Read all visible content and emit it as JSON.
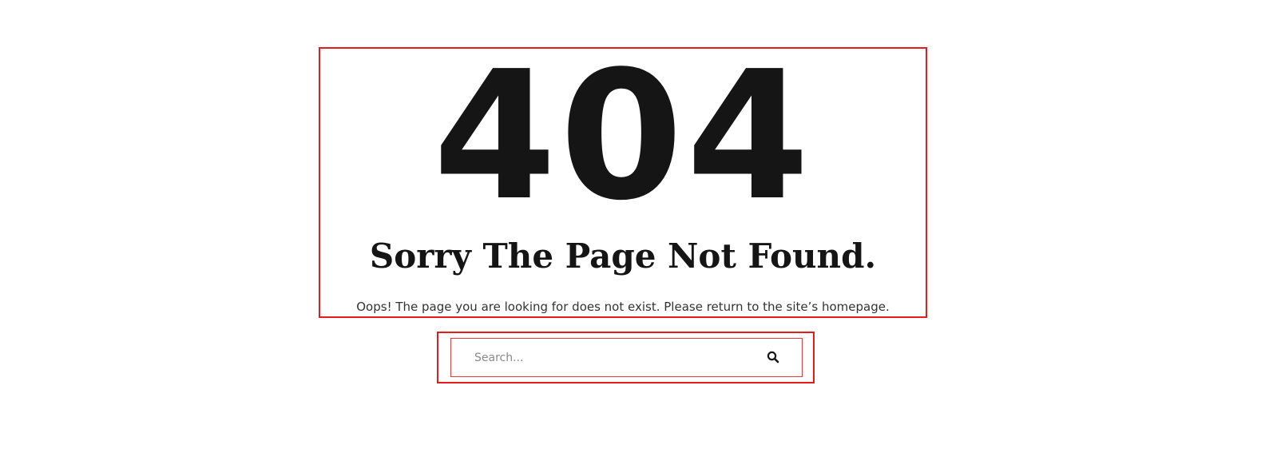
{
  "error": {
    "code": "404",
    "heading": "Sorry The Page Not Found.",
    "message": "Oops! The page you are looking for does not exist. Please return to the site’s homepage."
  },
  "search": {
    "placeholder": "Search...",
    "icon": "search-icon"
  },
  "colors": {
    "text_dark": "#151515",
    "highlight_border": "#e41c1c"
  }
}
